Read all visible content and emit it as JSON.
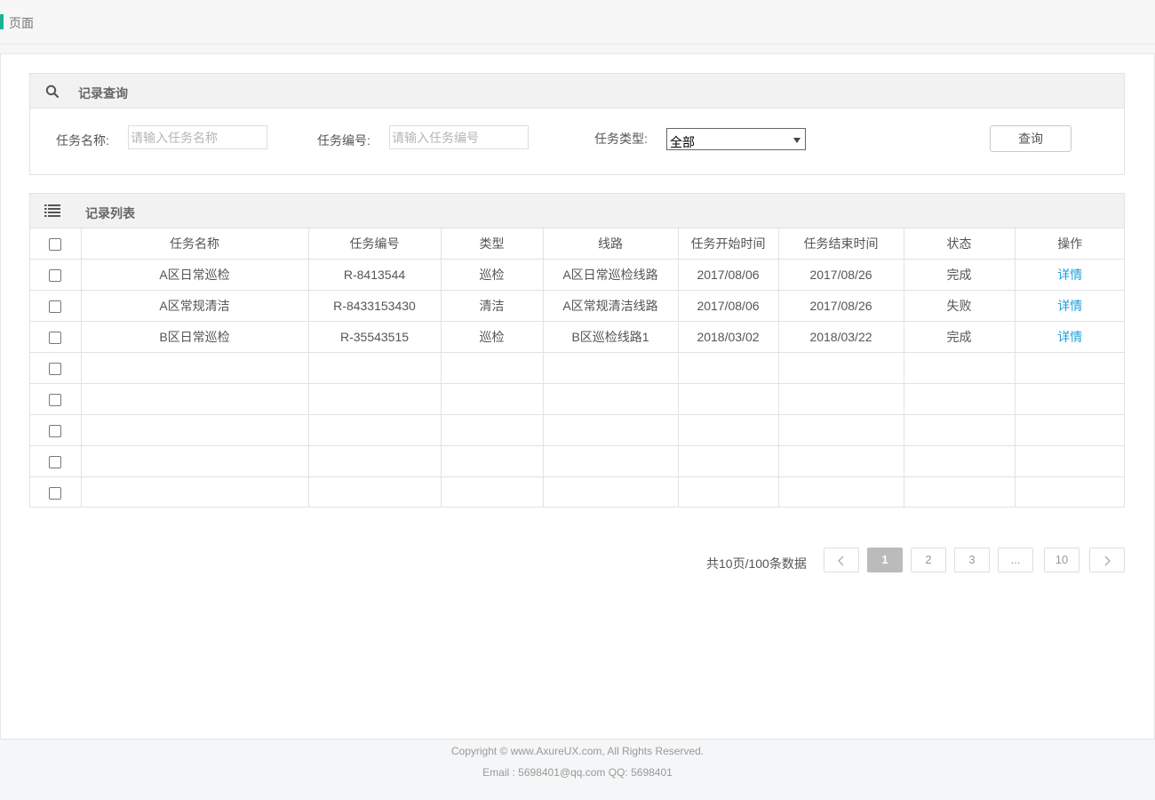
{
  "page": {
    "title": "页面"
  },
  "search": {
    "title": "记录查询",
    "task_name_label": "任务名称:",
    "task_name_placeholder": "请输入任务名称",
    "task_code_label": "任务编号:",
    "task_code_placeholder": "请输入任务编号",
    "task_type_label": "任务类型:",
    "task_type_value": "全部",
    "query_button": "查询"
  },
  "list": {
    "title": "记录列表",
    "columns": [
      "任务名称",
      "任务编号",
      "类型",
      "线路",
      "任务开始时间",
      "任务结束时间",
      "状态",
      "操作"
    ],
    "rows": [
      [
        "A区日常巡检",
        "R-8413544",
        "巡检",
        "A区日常巡检线路",
        "2017/08/06",
        "2017/08/26",
        "完成",
        "详情"
      ],
      [
        "A区常规清洁",
        "R-8433153430",
        "清洁",
        "A区常规清洁线路",
        "2017/08/06",
        "2017/08/26",
        "失败",
        "详情"
      ],
      [
        "B区日常巡检",
        "R-35543515",
        "巡检",
        "B区巡检线路1",
        "2018/03/02",
        "2018/03/22",
        "完成",
        "详情"
      ],
      [
        "",
        "",
        "",
        "",
        "",
        "",
        "",
        ""
      ],
      [
        "",
        "",
        "",
        "",
        "",
        "",
        "",
        ""
      ],
      [
        "",
        "",
        "",
        "",
        "",
        "",
        "",
        ""
      ],
      [
        "",
        "",
        "",
        "",
        "",
        "",
        "",
        ""
      ],
      [
        "",
        "",
        "",
        "",
        "",
        "",
        "",
        ""
      ]
    ]
  },
  "pagination": {
    "total_text": "共10页/100条数据",
    "prev": "<",
    "pages": [
      "1",
      "2",
      "3",
      "...",
      "10"
    ],
    "next": ">",
    "current": "1"
  },
  "footer": {
    "copyright": "Copyright © www.AxureUX.com, All Rights Reserved.",
    "contact": "Email : 5698401@qq.com  QQ: 5698401"
  },
  "colors": {
    "accent": "#1ab394",
    "link": "#1ca0dc"
  }
}
